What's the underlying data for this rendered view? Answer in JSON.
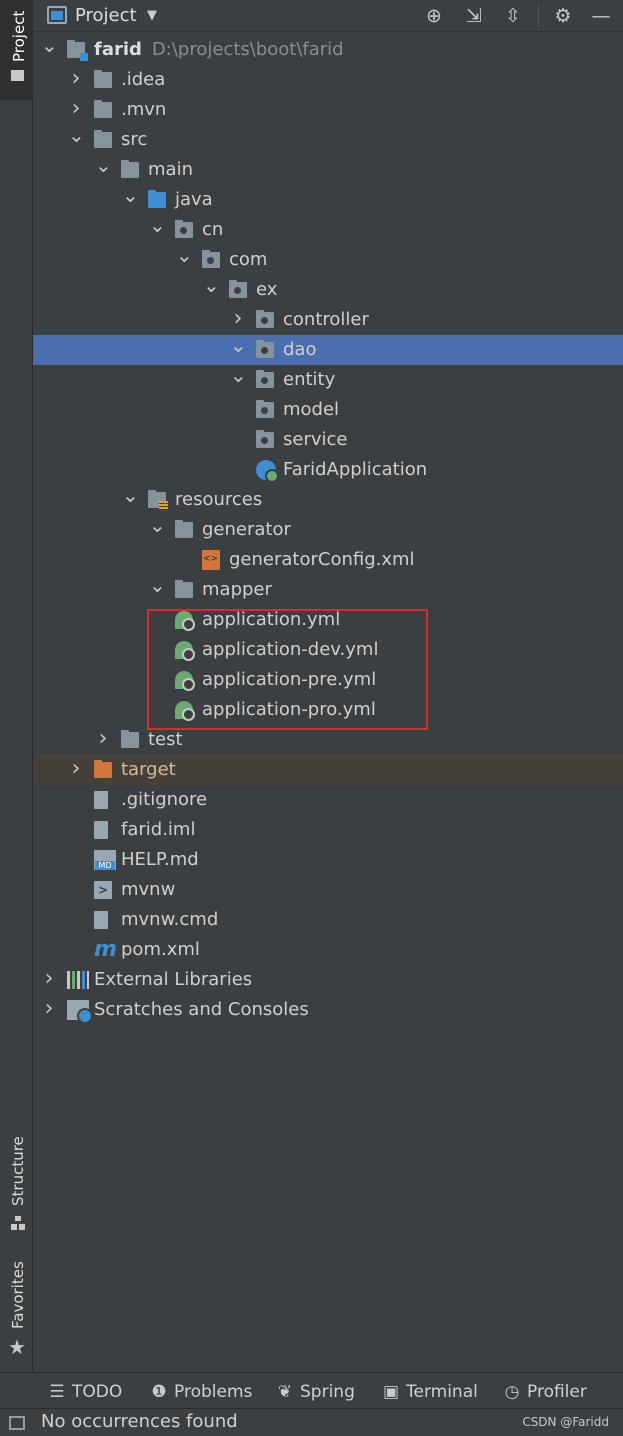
{
  "header": {
    "title": "Project",
    "icons": [
      "locate-icon",
      "expand-all-icon",
      "collapse-all-icon",
      "gear-icon",
      "hide-icon"
    ]
  },
  "left_strip": {
    "project_tab": "Project",
    "structure_tab": "Structure",
    "favorites_tab": "Favorites"
  },
  "tree": [
    {
      "label": "farid",
      "path": "D:\\projects\\boot\\farid",
      "depth": 0,
      "arrow": "down",
      "icon": "module-folder",
      "bold": true
    },
    {
      "label": ".idea",
      "depth": 1,
      "arrow": "right",
      "icon": "folder"
    },
    {
      "label": ".mvn",
      "depth": 1,
      "arrow": "right",
      "icon": "folder"
    },
    {
      "label": "src",
      "depth": 1,
      "arrow": "down",
      "icon": "folder"
    },
    {
      "label": "main",
      "depth": 2,
      "arrow": "down",
      "icon": "folder"
    },
    {
      "label": "java",
      "depth": 3,
      "arrow": "down",
      "icon": "source-folder"
    },
    {
      "label": "cn",
      "depth": 4,
      "arrow": "down",
      "icon": "package"
    },
    {
      "label": "com",
      "depth": 5,
      "arrow": "down",
      "icon": "package"
    },
    {
      "label": "ex",
      "depth": 6,
      "arrow": "down",
      "icon": "package"
    },
    {
      "label": "controller",
      "depth": 7,
      "arrow": "right",
      "icon": "package"
    },
    {
      "label": "dao",
      "depth": 7,
      "arrow": "down",
      "icon": "package",
      "selected": true
    },
    {
      "label": "entity",
      "depth": 7,
      "arrow": "down",
      "icon": "package"
    },
    {
      "label": "model",
      "depth": 7,
      "arrow": "",
      "icon": "package"
    },
    {
      "label": "service",
      "depth": 7,
      "arrow": "",
      "icon": "package"
    },
    {
      "label": "FaridApplication",
      "depth": 7,
      "arrow": "",
      "icon": "spring-app-class"
    },
    {
      "label": "resources",
      "depth": 3,
      "arrow": "down",
      "icon": "resources-folder"
    },
    {
      "label": "generator",
      "depth": 4,
      "arrow": "down",
      "icon": "folder"
    },
    {
      "label": "generatorConfig.xml",
      "depth": 5,
      "arrow": "",
      "icon": "xml-file"
    },
    {
      "label": "mapper",
      "depth": 4,
      "arrow": "down",
      "icon": "folder"
    },
    {
      "label": "application.yml",
      "depth": 4,
      "arrow": "",
      "icon": "spring-config"
    },
    {
      "label": "application-dev.yml",
      "depth": 4,
      "arrow": "",
      "icon": "spring-config"
    },
    {
      "label": "application-pre.yml",
      "depth": 4,
      "arrow": "",
      "icon": "spring-config"
    },
    {
      "label": "application-pro.yml",
      "depth": 4,
      "arrow": "",
      "icon": "spring-config"
    },
    {
      "label": "test",
      "depth": 2,
      "arrow": "right",
      "icon": "folder"
    },
    {
      "label": "target",
      "depth": 1,
      "arrow": "right",
      "icon": "excluded-folder",
      "excluded": true
    },
    {
      "label": ".gitignore",
      "depth": 1,
      "arrow": "",
      "icon": "ignore-file"
    },
    {
      "label": "farid.iml",
      "depth": 1,
      "arrow": "",
      "icon": "iml-file"
    },
    {
      "label": "HELP.md",
      "depth": 1,
      "arrow": "",
      "icon": "markdown-file"
    },
    {
      "label": "mvnw",
      "depth": 1,
      "arrow": "",
      "icon": "shell-file"
    },
    {
      "label": "mvnw.cmd",
      "depth": 1,
      "arrow": "",
      "icon": "text-file"
    },
    {
      "label": "pom.xml",
      "depth": 1,
      "arrow": "",
      "icon": "maven-file"
    },
    {
      "label": "External Libraries",
      "depth": 0,
      "arrow": "right",
      "icon": "libraries"
    },
    {
      "label": "Scratches and Consoles",
      "depth": 0,
      "arrow": "right",
      "icon": "scratches"
    }
  ],
  "bottom_tabs": [
    {
      "label": "TODO",
      "icon": "list-icon"
    },
    {
      "label": "Problems",
      "icon": "problems-icon"
    },
    {
      "label": "Spring",
      "icon": "spring-icon"
    },
    {
      "label": "Terminal",
      "icon": "terminal-icon"
    },
    {
      "label": "Profiler",
      "icon": "profiler-icon"
    }
  ],
  "status": {
    "text": "No occurrences found",
    "watermark": "CSDN @Faridd"
  },
  "colors": {
    "background": "#3c3f41",
    "selection": "#4b6eaf",
    "highlight_box": "#e0272c",
    "excluded_folder": "#d4763b",
    "source_folder": "#3d8fd1"
  }
}
